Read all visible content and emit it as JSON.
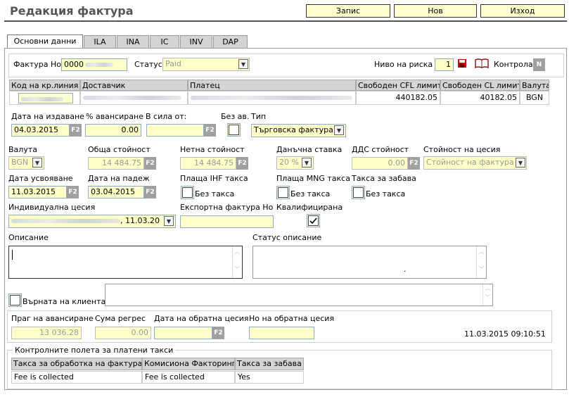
{
  "header": {
    "title": "Редакция фактура",
    "save": "Запис",
    "new": "Нов",
    "exit": "Изход"
  },
  "tabs": [
    "Основни данни",
    "ILA",
    "INA",
    "IC",
    "INV",
    "DAP"
  ],
  "invoice_no": {
    "label": "Фактура Но",
    "value": "0000"
  },
  "status": {
    "label": "Статус",
    "value": "Paid"
  },
  "risk": {
    "label": "Ниво на риска",
    "value": "1"
  },
  "control": {
    "label": "Контрола",
    "value": "N"
  },
  "grid": {
    "headers": [
      "Код на кр.линия",
      "Доставчик",
      "Платец",
      "Свободен CFL лимит",
      "Свободен CL лимит",
      "Валута"
    ],
    "row": [
      "",
      "",
      "",
      "440182.05",
      "40182.05",
      "BGN"
    ]
  },
  "issue_date": {
    "label": "Дата на издаване",
    "value": "04.03.2015"
  },
  "advance_pct": {
    "label": "% авансиране",
    "value": "0.00"
  },
  "effective_from": {
    "label": "В сила от:",
    "value": ""
  },
  "no_advance": {
    "label": "Без ав."
  },
  "type": {
    "label": "Тип",
    "value": "Търговска фактура"
  },
  "currency": {
    "label": "Валута",
    "value": "BGN"
  },
  "total_value": {
    "label": "Обща стойност",
    "value": "14 484.75"
  },
  "net_value": {
    "label": "Нетна стойност",
    "value": "14 484.75"
  },
  "tax_rate": {
    "label": "Данъчна ставка",
    "value": "20 %"
  },
  "vat_value": {
    "label": "ДДС стойност",
    "value": "0.00"
  },
  "cession_value": {
    "label": "Стойност на цесия",
    "value": "Стойност на фактура"
  },
  "acceptance_date": {
    "label": "Дата усвояване",
    "value": "11.03.2015"
  },
  "due_date": {
    "label": "Дата на падеж",
    "value": "03.04.2015"
  },
  "ihf_fee": {
    "label": "Плаща IHF такса",
    "check_label": "Без такса"
  },
  "mng_fee": {
    "label": "Плаща MNG такса",
    "check_label": "Без такса"
  },
  "late_fee": {
    "label": "Такса за забава",
    "check_label": "Без такса"
  },
  "individual_cession": {
    "label": "Индивидуална цесия",
    "value": ", 11.03.20"
  },
  "export_invoice": {
    "label": "Експортна фактура Но",
    "value": ""
  },
  "qualified": {
    "label": "Квалифицирана"
  },
  "description": {
    "label": "Описание",
    "value": ""
  },
  "status_description": {
    "label": "Статус описание",
    "value": "."
  },
  "returned": {
    "label": "Върната на клиента"
  },
  "advance_threshold": {
    "label": "Праг на авансиране",
    "value": "13 036.28"
  },
  "regress_sum": {
    "label": "Сума регрес",
    "value": "0.00"
  },
  "reverse_cession_date": {
    "label": "Дата на обратна цесия",
    "value": ""
  },
  "reverse_cession_no": {
    "label": "Но на обратна цесия",
    "value": ""
  },
  "timestamp": "11.03.2015 09:10:51",
  "control_fields": {
    "legend": "Контролните полета за платени такси",
    "headers": [
      "Такса за обработка на фактура",
      "Комисиона Факторинг",
      "Такса за забава"
    ],
    "row": [
      "Fee is collected",
      "Fee is collected",
      "Yes"
    ]
  },
  "f2_label": "F2",
  "colors": {
    "input_bg": "#ffffc8",
    "button_bg": "#ffffd0",
    "header_bg": "#d4d4d4"
  }
}
